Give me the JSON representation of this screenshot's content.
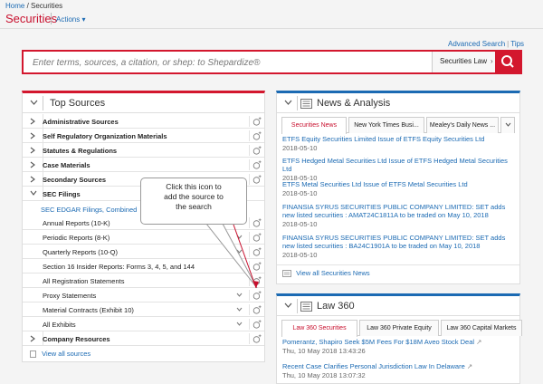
{
  "breadcrumb": {
    "home": "Home",
    "sep": " / ",
    "current": "Securities"
  },
  "app": {
    "title": "Securities",
    "actions": "Actions"
  },
  "links": {
    "advanced": "Advanced Search",
    "sep": "|",
    "tips": "Tips"
  },
  "search": {
    "placeholder": "Enter terms, sources, a citation, or shep: to Shepardize®",
    "scope": "Securities Law"
  },
  "top_sources": {
    "title": "Top Sources",
    "rows": [
      {
        "label": "Administrative Sources"
      },
      {
        "label": "Self Regulatory Organization Materials"
      },
      {
        "label": "Statutes & Regulations"
      },
      {
        "label": "Case Materials"
      },
      {
        "label": "Secondary Sources"
      },
      {
        "label": "SEC Filings"
      }
    ],
    "combined": "SEC EDGAR Filings, Combined",
    "subrows": [
      {
        "label": "Annual Reports (10-K)"
      },
      {
        "label": "Periodic Reports (8-K)"
      },
      {
        "label": "Quarterly Reports (10-Q)"
      },
      {
        "label": "Section 16 Insider Reports: Forms 3, 4, 5, and 144"
      },
      {
        "label": "All Registration Statements"
      },
      {
        "label": "Proxy Statements"
      },
      {
        "label": "Material Contracts (Exhibit 10)"
      },
      {
        "label": "All Exhibits"
      }
    ],
    "last_row": "Company Resources",
    "view_all": "View all sources"
  },
  "callout": {
    "line1": "Click this icon to",
    "line2": "add the source  to",
    "line3": "the search"
  },
  "news": {
    "title": "News & Analysis",
    "tabs": [
      "Securities News",
      "New York Times Busi...",
      "Mealey's Daily News ..."
    ],
    "items": [
      {
        "title": "ETFS Equity Securities Limited Issue of ETFS Equity Securities Ltd",
        "date": "2018-05-10"
      },
      {
        "title": "ETFS Hedged Metal Securities Ltd Issue of ETFS Hedged Metal Securities Ltd",
        "date": "2018-05-10"
      },
      {
        "title": "ETFS Metal Securities Ltd Issue of ETFS Metal Securities Ltd",
        "date": "2018-05-10"
      },
      {
        "title": "FINANSIA SYRUS SECURITIES PUBLIC COMPANY LIMITED: SET adds new listed securities : AMAT24C1811A to be traded on May 10, 2018",
        "date": "2018-05-10"
      },
      {
        "title": "FINANSIA SYRUS SECURITIES PUBLIC COMPANY LIMITED: SET adds new listed securities : BA24C1901A to be traded on May 10, 2018",
        "date": "2018-05-10"
      }
    ],
    "view_all": "View all Securities News"
  },
  "law360": {
    "title": "Law 360",
    "tabs": [
      "Law 360 Securities",
      "Law 360 Private Equity",
      "Law 360 Capital Markets"
    ],
    "items": [
      {
        "title": "Pomerantz, Shapiro Seek $5M Fees For $18M Aveo Stock Deal",
        "date": "Thu, 10 May 2018 13:43:26"
      },
      {
        "title": "Recent Case Clarifies Personal Jurisdiction Law In Delaware",
        "date": "Thu, 10 May 2018 13:07:32"
      }
    ]
  }
}
